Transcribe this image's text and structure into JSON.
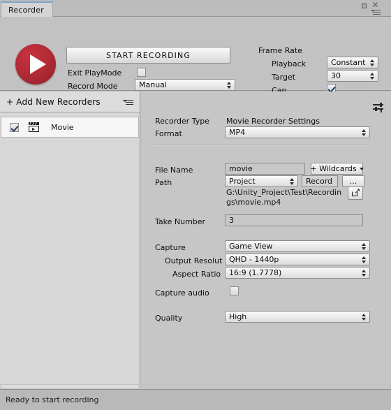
{
  "window": {
    "tab_label": "Recorder",
    "maximize_icon": "maximize-icon",
    "close_icon": "close-icon",
    "menu_icon": "hamburger-menu-icon"
  },
  "top_panel": {
    "record_button_icon": "play-record-icon",
    "start_recording_label": "START RECORDING",
    "exit_playmode_label": "Exit PlayMode",
    "exit_playmode_checked": false,
    "record_mode_label": "Record Mode",
    "record_mode_value": "Manual",
    "frame_rate_title": "Frame Rate",
    "playback_label": "Playback",
    "playback_value": "Constant",
    "target_label": "Target",
    "target_value": "30",
    "cap_label": "Cap",
    "cap_checked": true
  },
  "recorder_list": {
    "add_label": "+ Add New Recorders",
    "options_icon": "options-menu-icon",
    "items": [
      {
        "label": "Movie",
        "enabled": true,
        "icon": "clapperboard-icon"
      }
    ]
  },
  "settings": {
    "presets_icon": "presets-sliders-icon",
    "recorder_type_label": "Recorder Type",
    "recorder_type_value": "Movie Recorder Settings",
    "format_label": "Format",
    "format_value": "MP4",
    "file_name_label": "File Name",
    "file_name_value": "movie",
    "wildcards_label": "+ Wildcards",
    "path_label": "Path",
    "path_source_value": "Project",
    "path_folder_value": "Record",
    "browse_label": "...",
    "full_path_value": "G:\\Unity_Project\\Test\\Recordings\\movie.mp4",
    "open_folder_icon": "external-link-icon",
    "take_number_label": "Take Number",
    "take_number_value": "3",
    "capture_label": "Capture",
    "capture_value": "Game View",
    "output_resolution_label": "Output Resolut",
    "output_resolution_value": "QHD - 1440p",
    "aspect_ratio_label": "Aspect Ratio",
    "aspect_ratio_value": "16:9 (1.7778)",
    "capture_audio_label": "Capture audio",
    "capture_audio_checked": false,
    "quality_label": "Quality",
    "quality_value": "High"
  },
  "status": {
    "message": "Ready to start recording"
  },
  "colors": {
    "record_red": "#b22b35",
    "tab_accent": "#7ea5c8",
    "panel_bg": "#c2c2c2",
    "settings_bg": "#c6c6c6",
    "list_bg": "#d7d7d7"
  }
}
